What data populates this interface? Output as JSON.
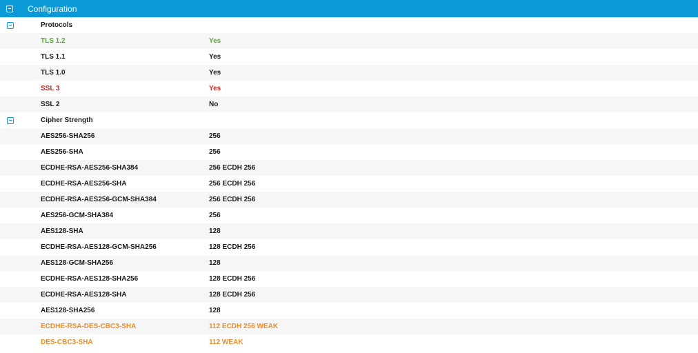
{
  "header": {
    "title": "Configuration"
  },
  "sections": [
    {
      "label": "Protocols",
      "rows": [
        {
          "name": "TLS 1.2",
          "value": "Yes",
          "status": "green"
        },
        {
          "name": "TLS 1.1",
          "value": "Yes",
          "status": "normal"
        },
        {
          "name": "TLS 1.0",
          "value": "Yes",
          "status": "normal"
        },
        {
          "name": "SSL 3",
          "value": "Yes",
          "status": "red"
        },
        {
          "name": "SSL 2",
          "value": "No",
          "status": "normal"
        }
      ]
    },
    {
      "label": "Cipher Strength",
      "rows": [
        {
          "name": "AES256-SHA256",
          "value": "256",
          "status": "normal"
        },
        {
          "name": "AES256-SHA",
          "value": "256",
          "status": "normal"
        },
        {
          "name": "ECDHE-RSA-AES256-SHA384",
          "value": "256 ECDH 256",
          "status": "normal"
        },
        {
          "name": "ECDHE-RSA-AES256-SHA",
          "value": "256 ECDH 256",
          "status": "normal"
        },
        {
          "name": "ECDHE-RSA-AES256-GCM-SHA384",
          "value": "256 ECDH 256",
          "status": "normal"
        },
        {
          "name": "AES256-GCM-SHA384",
          "value": "256",
          "status": "normal"
        },
        {
          "name": "AES128-SHA",
          "value": "128",
          "status": "normal"
        },
        {
          "name": "ECDHE-RSA-AES128-GCM-SHA256",
          "value": "128 ECDH 256",
          "status": "normal"
        },
        {
          "name": "AES128-GCM-SHA256",
          "value": "128",
          "status": "normal"
        },
        {
          "name": "ECDHE-RSA-AES128-SHA256",
          "value": "128 ECDH 256",
          "status": "normal"
        },
        {
          "name": "ECDHE-RSA-AES128-SHA",
          "value": "128 ECDH 256",
          "status": "normal"
        },
        {
          "name": "AES128-SHA256",
          "value": "128",
          "status": "normal"
        },
        {
          "name": "ECDHE-RSA-DES-CBC3-SHA",
          "value": "112 ECDH 256 WEAK",
          "status": "orange"
        },
        {
          "name": "DES-CBC3-SHA",
          "value": "112 WEAK",
          "status": "orange"
        }
      ]
    }
  ],
  "colors": {
    "accent": "#0b9ad8",
    "green": "#5aa83a",
    "red": "#c62828",
    "orange": "#ee8e2c",
    "stripe": "#f6f6f6"
  },
  "icons": {
    "collapse": "minus-square-icon"
  }
}
